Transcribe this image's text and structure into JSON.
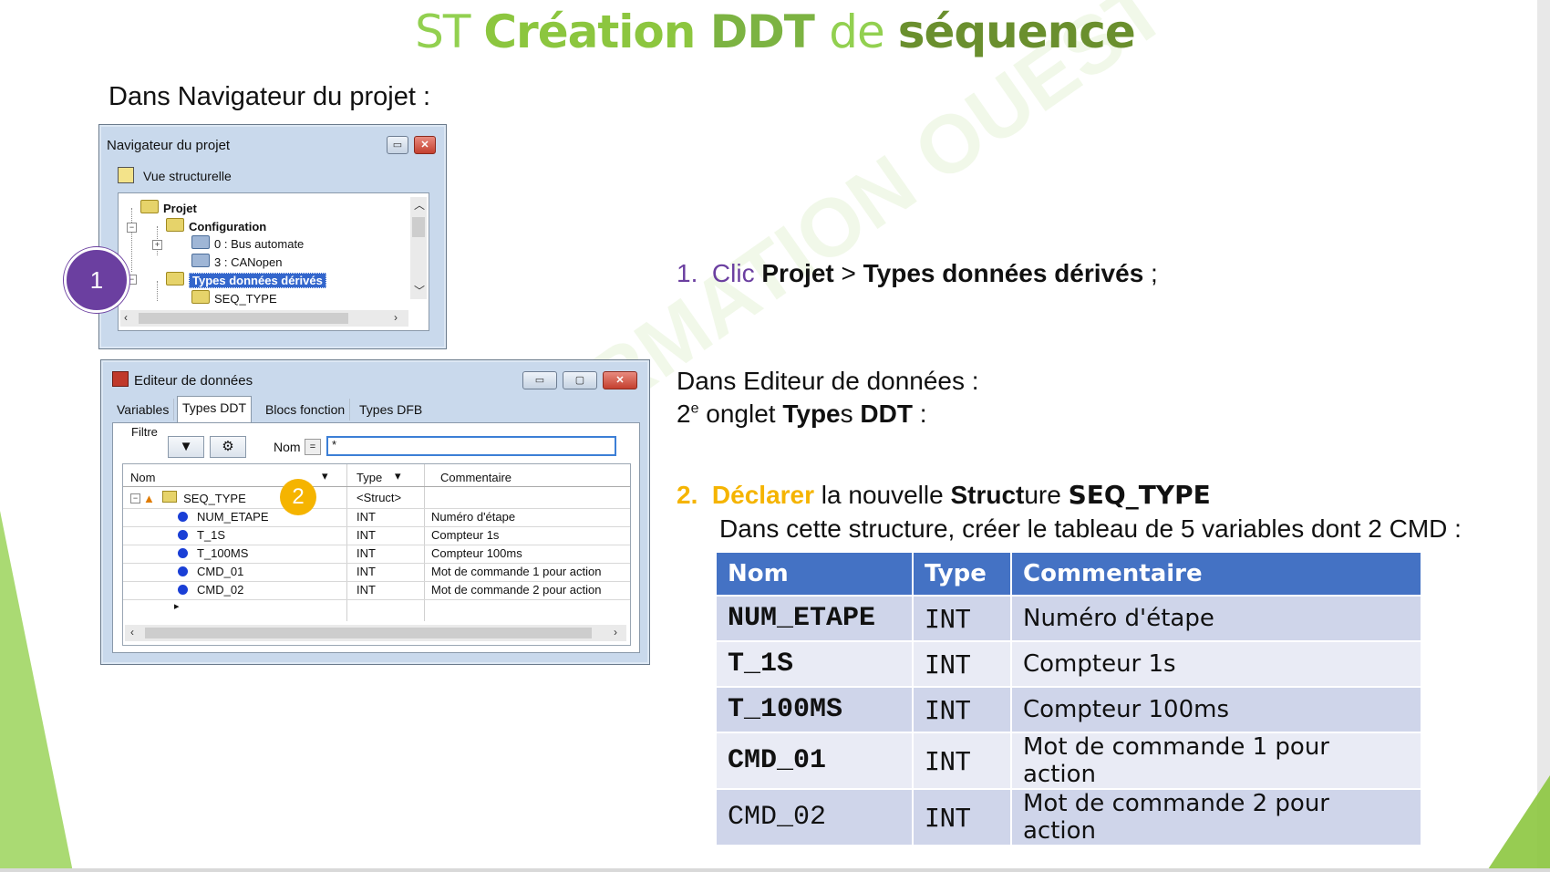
{
  "title": {
    "part1": "ST ",
    "part2": "Création ",
    "part3": "DDT ",
    "part4": "de ",
    "part5": "séquence"
  },
  "nav_heading": "Dans Navigateur du projet :",
  "navigator": {
    "title": "Navigateur du projet",
    "view_label": "Vue structurelle",
    "tree": {
      "projet": "Projet",
      "configuration": "Configuration",
      "bus": "0 : Bus automate",
      "canopen": "3 : CANopen",
      "ddt": "Types données dérivés",
      "seq": "SEQ_TYPE"
    }
  },
  "editor": {
    "title": "Editeur de données",
    "tabs": [
      "Variables",
      "Types DDT",
      "Blocs fonction",
      "Types DFB"
    ],
    "filter_label": "Filtre",
    "name_label": "Nom",
    "equals": "=",
    "filter_value": "*",
    "columns": [
      "Nom",
      "Type",
      "Commentaire"
    ],
    "struct_row": {
      "name": "SEQ_TYPE",
      "type": "<Struct>"
    },
    "rows": [
      {
        "name": "NUM_ETAPE",
        "type": "INT",
        "comment": "Numéro d'étape"
      },
      {
        "name": "T_1S",
        "type": "INT",
        "comment": "Compteur 1s"
      },
      {
        "name": "T_100MS",
        "type": "INT",
        "comment": "Compteur 100ms"
      },
      {
        "name": "CMD_01",
        "type": "INT",
        "comment": "Mot de commande 1 pour action"
      },
      {
        "name": "CMD_02",
        "type": "INT",
        "comment": "Mot de commande 2 pour action"
      }
    ],
    "new_row_marker": "▸"
  },
  "badges": {
    "one": "1",
    "two": "2"
  },
  "watermark": "AEI FORMATION OUEST",
  "step1": {
    "num": "1.",
    "clic": "Clic ",
    "projet": "Projet",
    "gt": " > ",
    "types": "Types données dérivés",
    "end": " ;"
  },
  "editor_heading": "Dans Editeur de données :",
  "tab_line": {
    "prefix": "2",
    "sup": "e",
    "mid": " onglet ",
    "b1": "Type",
    "s": "s",
    "b2": " DDT",
    "end": " :"
  },
  "step2": {
    "num": "2.",
    "verb": "Déclarer",
    "mid": " la nouvelle ",
    "struct_b": "Struct",
    "struct_rest": "ure ",
    "name": "SEQ_TYPE",
    "line2": "Dans cette structure, créer le tableau de 5 variables dont 2 CMD :"
  },
  "table": {
    "headers": [
      "Nom",
      "Type",
      "Commentaire"
    ],
    "rows": [
      [
        "NUM_ETAPE",
        "INT",
        "Numéro d'étape"
      ],
      [
        "T_1S",
        "INT",
        "Compteur 1s"
      ],
      [
        "T_100MS",
        "INT",
        "Compteur 100ms"
      ],
      [
        "CMD_01",
        "INT",
        "Mot de commande 1 pour action"
      ],
      [
        "CMD_02",
        "INT",
        "Mot de commande 2 pour action"
      ]
    ]
  },
  "colors": {
    "title_green": "#92d050",
    "header_blue": "#4472c4",
    "badge_purple": "#6b3fa0",
    "badge_orange": "#f5b400"
  }
}
